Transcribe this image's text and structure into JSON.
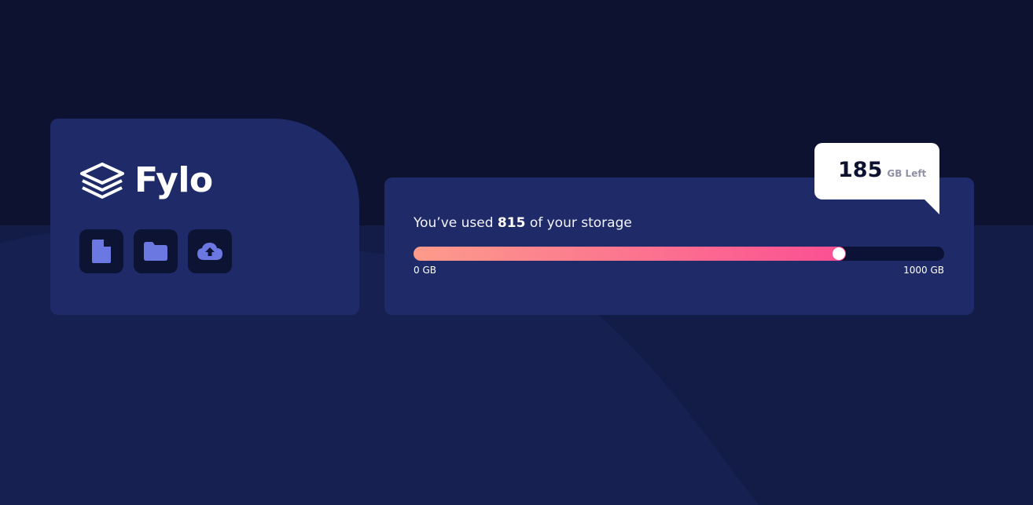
{
  "brand": {
    "name": "Fylo",
    "logo_icon": "stacked-layers-icon"
  },
  "actions": [
    {
      "icon": "document-icon",
      "name": "document-button"
    },
    {
      "icon": "folder-icon",
      "name": "folder-button"
    },
    {
      "icon": "upload-icon",
      "name": "upload-button"
    }
  ],
  "storage": {
    "prefix": "You’ve used",
    "used": "815",
    "suffix": "of your storage",
    "used_fraction": 0.815,
    "min_label": "0 GB",
    "max_label": "1000 GB",
    "remaining": "185",
    "remaining_label": "GB Left"
  },
  "colors": {
    "background": "#0c1230",
    "card": "#1f2b68",
    "accent_start": "#fd9b8b",
    "accent_end": "#fb4f93",
    "icon_fill": "#6b78e1"
  }
}
